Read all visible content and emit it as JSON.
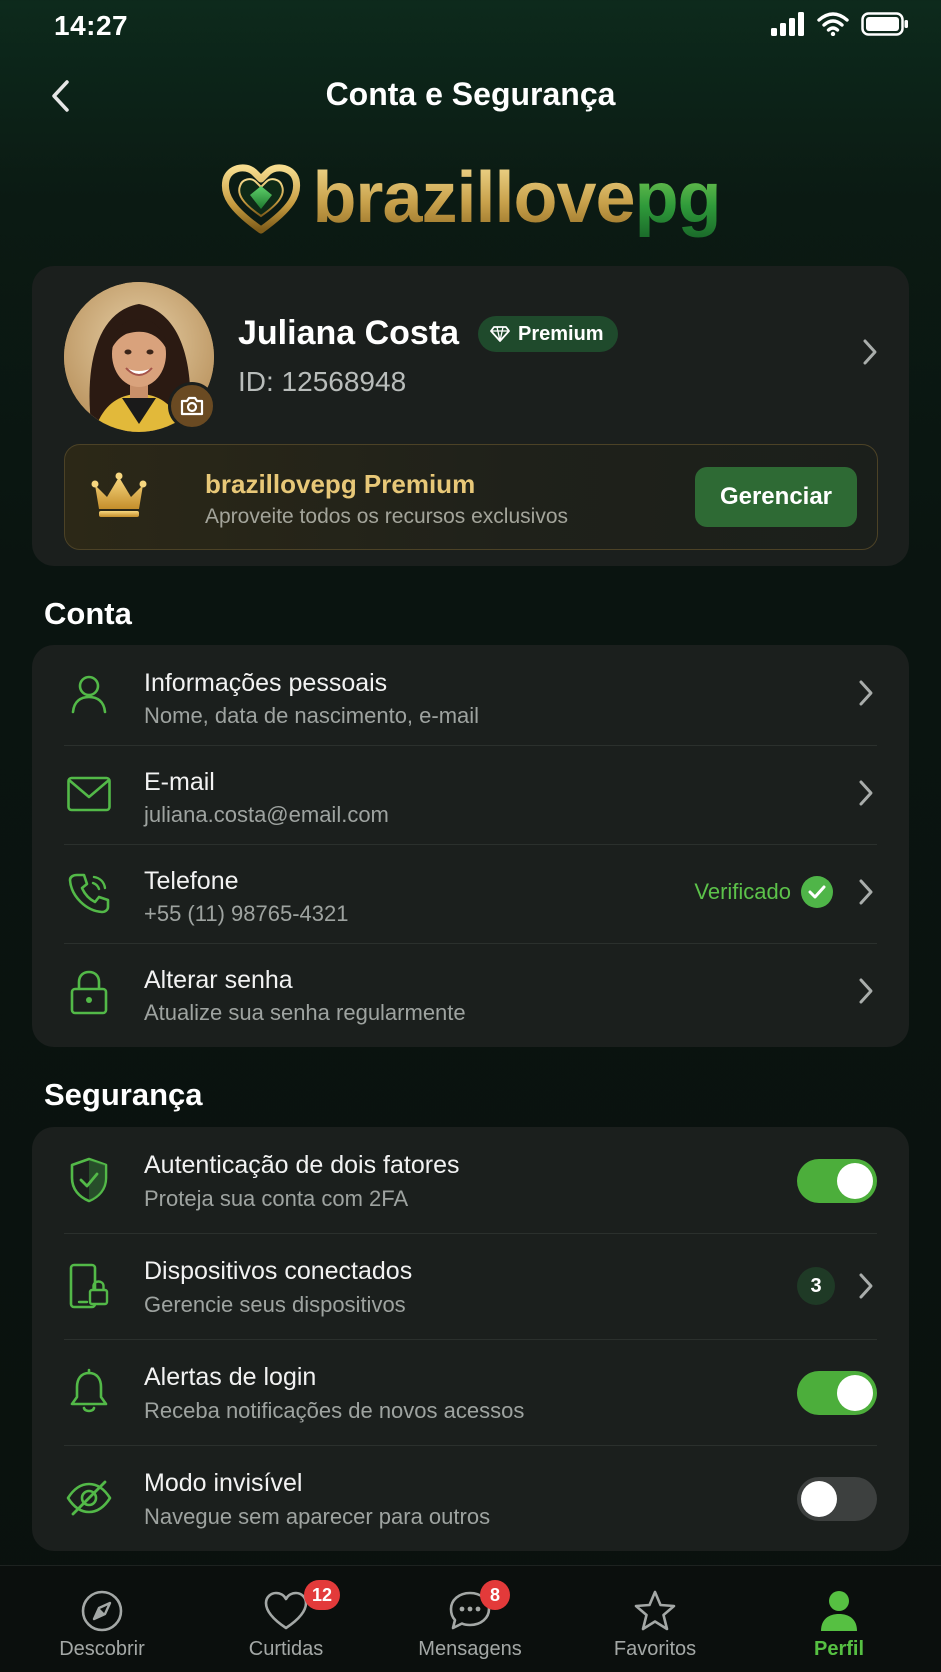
{
  "status_bar": {
    "time": "14:27"
  },
  "header": {
    "title": "Conta e Segurança"
  },
  "logo": {
    "gold_text": "brazillove",
    "green_text": "pg"
  },
  "profile": {
    "name": "Juliana Costa",
    "badge": "Premium",
    "id_text": "ID: 12568948"
  },
  "premium_banner": {
    "title": "brazillovepg Premium",
    "subtitle": "Aproveite todos os recursos exclusivos",
    "button": "Gerenciar"
  },
  "account_section": {
    "title": "Conta",
    "items": [
      {
        "title": "Informações pessoais",
        "subtitle": "Nome, data de nascimento, e-mail",
        "icon": "user-icon"
      },
      {
        "title": "E-mail",
        "subtitle": "juliana.costa@email.com",
        "icon": "mail-icon"
      },
      {
        "title": "Telefone",
        "subtitle": "+55 (11) 98765-4321",
        "icon": "phone-icon",
        "status": "Verificado"
      },
      {
        "title": "Alterar senha",
        "subtitle": "Atualize sua senha regularmente",
        "icon": "lock-icon"
      }
    ]
  },
  "security_section": {
    "title": "Segurança",
    "items": [
      {
        "title": "Autenticação de dois fatores",
        "subtitle": "Proteja sua conta com 2FA",
        "icon": "shield-check-icon",
        "toggle": true
      },
      {
        "title": "Dispositivos conectados",
        "subtitle": "Gerencie seus dispositivos",
        "icon": "devices-icon",
        "count": "3"
      },
      {
        "title": "Alertas de login",
        "subtitle": "Receba notificações de novos acessos",
        "icon": "bell-icon",
        "toggle": true
      },
      {
        "title": "Modo invisível",
        "subtitle": "Navegue sem aparecer para outros",
        "icon": "eye-off-icon",
        "toggle": false
      }
    ]
  },
  "bottom_nav": {
    "items": [
      {
        "label": "Descobrir",
        "icon": "compass-icon",
        "active": false
      },
      {
        "label": "Curtidas",
        "icon": "heart-icon",
        "badge": "12",
        "active": false
      },
      {
        "label": "Mensagens",
        "icon": "chat-icon",
        "badge": "8",
        "active": false
      },
      {
        "label": "Favoritos",
        "icon": "star-icon",
        "active": false
      },
      {
        "label": "Perfil",
        "icon": "person-icon",
        "active": true
      }
    ]
  },
  "colors": {
    "accent_green": "#4cae3b",
    "gold": "#e8c878",
    "card_bg": "#1b1f1d",
    "badge_red": "#e33a3a"
  }
}
